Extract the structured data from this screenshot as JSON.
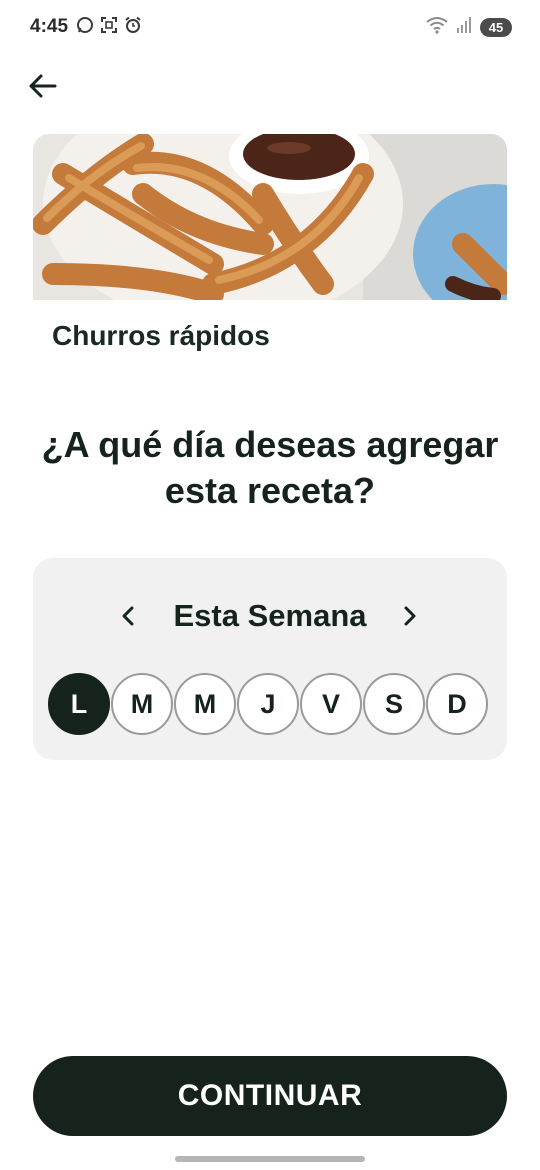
{
  "status_bar": {
    "time": "4:45",
    "battery": "45",
    "left_icons": [
      "whatsapp-icon",
      "screenshot-icon",
      "alarm-icon"
    ],
    "right_icons": [
      "wifi-icon",
      "signal-icon"
    ]
  },
  "header": {
    "back_icon": "arrow-left-icon"
  },
  "recipe": {
    "title": "Churros rápidos"
  },
  "question": "¿A qué día deseas agregar esta receta?",
  "week_picker": {
    "label": "Esta Semana",
    "prev_icon": "chevron-left-icon",
    "next_icon": "chevron-right-icon",
    "days": [
      "L",
      "M",
      "M",
      "J",
      "V",
      "S",
      "D"
    ],
    "selected_index": 0
  },
  "actions": {
    "continue_label": "CONTINUAR"
  },
  "colors": {
    "primary": "#16231d",
    "card_bg": "#f1f1f1",
    "day_border": "#9a9a9a"
  }
}
